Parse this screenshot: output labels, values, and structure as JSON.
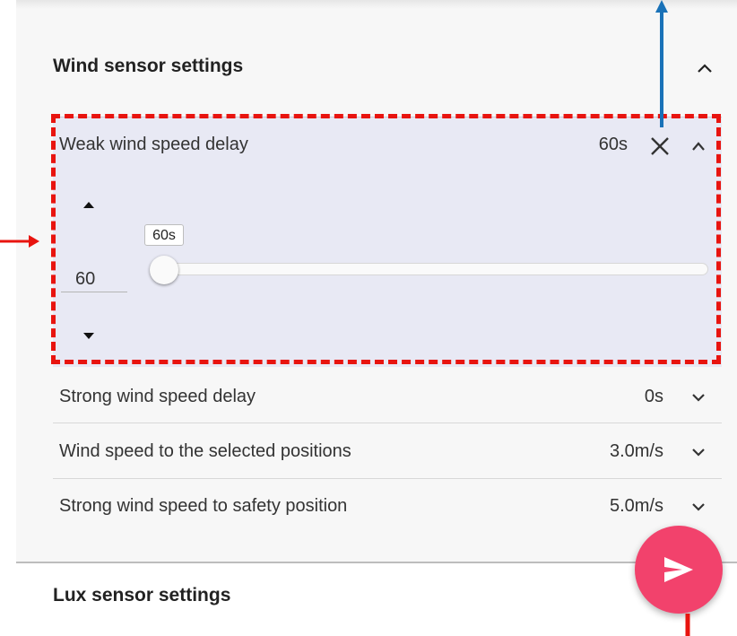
{
  "wind_section": {
    "title": "Wind sensor settings"
  },
  "weak_wind": {
    "label": "Weak wind speed delay",
    "value": "60s",
    "input_value": "60",
    "slider_tooltip": "60s",
    "slider_level": 0
  },
  "rows": [
    {
      "label": "Strong wind speed delay",
      "value": "0s"
    },
    {
      "label": "Wind speed to the selected positions",
      "value": "3.0m/s"
    },
    {
      "label": "Strong wind speed to safety position",
      "value": "5.0m/s"
    }
  ],
  "lux_section": {
    "title": "Lux sensor settings"
  },
  "icons": {
    "section_toggle": "chevron-up-icon",
    "clear": "close-icon",
    "row_toggle": "chevron-down-icon",
    "spin_up": "triangle-up-icon",
    "spin_down": "triangle-down-icon",
    "send": "send-icon"
  },
  "colors": {
    "fab": "#f2426c",
    "highlight": "#e8140f",
    "expanded_bg": "#e8e9f4",
    "annotation_blue": "#1a72b8"
  }
}
